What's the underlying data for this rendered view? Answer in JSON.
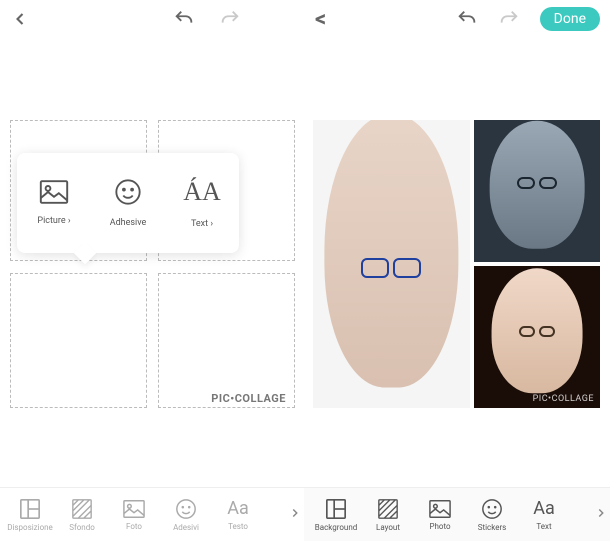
{
  "top": {
    "done_label": "Done"
  },
  "popup": {
    "picture_label": "Picture ›",
    "adhesive_label": "Adhesive",
    "text_label": "Text ›",
    "aa_glyph": "ÁA"
  },
  "watermark_left": "PIC•COLLAGE",
  "watermark_right": "PIC•COLLAGE",
  "toolbar_left": {
    "items": [
      {
        "label": "Disposizione"
      },
      {
        "label": "Sfondo"
      },
      {
        "label": "Foto"
      },
      {
        "label": "Adesivi"
      },
      {
        "label": "Testo"
      }
    ],
    "aa_glyph": "Aa"
  },
  "toolbar_right": {
    "items": [
      {
        "label": "Background"
      },
      {
        "label": "Layout"
      },
      {
        "label": "Photo"
      },
      {
        "label": "Stickers"
      },
      {
        "label": "Text"
      }
    ],
    "aa_glyph": "Aa"
  }
}
